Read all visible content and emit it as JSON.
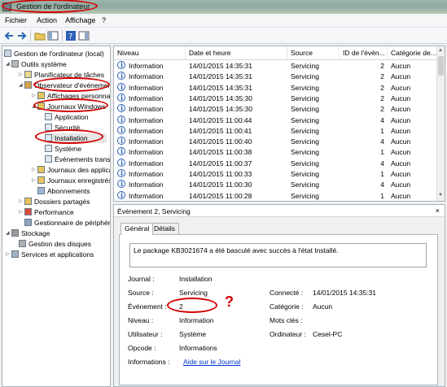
{
  "window": {
    "title": "Gestion de l'ordinateur"
  },
  "menu": {
    "items": [
      "Fichier",
      "Action",
      "Affichage",
      "?"
    ]
  },
  "toolbar": {
    "icons": [
      "back-icon",
      "forward-icon",
      "folder-icon",
      "view-icon",
      "help-icon",
      "panel-icon"
    ]
  },
  "tree": {
    "items": [
      {
        "label": "Gestion de l'ordinateur (local)"
      },
      {
        "label": "Outils système"
      },
      {
        "label": "Planificateur de tâches"
      },
      {
        "label": "Observateur d'événements"
      },
      {
        "label": "Affichages personnalisés"
      },
      {
        "label": "Journaux Windows"
      },
      {
        "label": "Application"
      },
      {
        "label": "Sécurité"
      },
      {
        "label": "Installation"
      },
      {
        "label": "Système"
      },
      {
        "label": "Événements transférés"
      },
      {
        "label": "Journaux des applications"
      },
      {
        "label": "Journaux enregistrés"
      },
      {
        "label": "Abonnements"
      },
      {
        "label": "Dossiers partagés"
      },
      {
        "label": "Performance"
      },
      {
        "label": "Gestionnaire de périphériques"
      },
      {
        "label": "Stockage"
      },
      {
        "label": "Gestion des disques"
      },
      {
        "label": "Services et applications"
      }
    ]
  },
  "list": {
    "columns": [
      "Niveau",
      "Date et heure",
      "Source",
      "ID de l'évén...",
      "Catégorie de..."
    ],
    "rows": [
      {
        "level": "Information",
        "date": "14/01/2015 14:35:31",
        "source": "Servicing",
        "id": "2",
        "category": "Aucun"
      },
      {
        "level": "Information",
        "date": "14/01/2015 14:35:31",
        "source": "Servicing",
        "id": "2",
        "category": "Aucun"
      },
      {
        "level": "Information",
        "date": "14/01/2015 14:35:31",
        "source": "Servicing",
        "id": "2",
        "category": "Aucun"
      },
      {
        "level": "Information",
        "date": "14/01/2015 14:35:30",
        "source": "Servicing",
        "id": "2",
        "category": "Aucun"
      },
      {
        "level": "Information",
        "date": "14/01/2015 14:35:30",
        "source": "Servicing",
        "id": "2",
        "category": "Aucun"
      },
      {
        "level": "Information",
        "date": "14/01/2015 11:00:44",
        "source": "Servicing",
        "id": "4",
        "category": "Aucun"
      },
      {
        "level": "Information",
        "date": "14/01/2015 11:00:41",
        "source": "Servicing",
        "id": "1",
        "category": "Aucun"
      },
      {
        "level": "Information",
        "date": "14/01/2015 11:00:40",
        "source": "Servicing",
        "id": "4",
        "category": "Aucun"
      },
      {
        "level": "Information",
        "date": "14/01/2015 11:00:38",
        "source": "Servicing",
        "id": "1",
        "category": "Aucun"
      },
      {
        "level": "Information",
        "date": "14/01/2015 11:00:37",
        "source": "Servicing",
        "id": "4",
        "category": "Aucun"
      },
      {
        "level": "Information",
        "date": "14/01/2015 11:00:33",
        "source": "Servicing",
        "id": "1",
        "category": "Aucun"
      },
      {
        "level": "Information",
        "date": "14/01/2015 11:00:30",
        "source": "Servicing",
        "id": "4",
        "category": "Aucun"
      },
      {
        "level": "Information",
        "date": "14/01/2015 11:00:28",
        "source": "Servicing",
        "id": "1",
        "category": "Aucun"
      }
    ]
  },
  "detail": {
    "title": "Événement 2, Servicing",
    "close": "×",
    "tabs": [
      "Général",
      "Détails"
    ],
    "message": "Le package KB3021674 a été basculé avec succès à l'état Installé.",
    "fields": {
      "journal_label": "Journal :",
      "journal_value": "Installation",
      "source_label": "Source :",
      "source_value": "Servicing",
      "event_label": "Événement :",
      "event_value": "2",
      "level_label": "Niveau :",
      "level_value": "Information",
      "user_label": "Utilisateur :",
      "user_value": "Système",
      "opcode_label": "Opcode :",
      "opcode_value": "Informations",
      "info_label": "Informations :",
      "info_link": "Aide sur le Journal",
      "logged_label": "Connecté :",
      "logged_value": "14/01/2015 14:35:31",
      "category_label": "Catégorie :",
      "category_value": "Aucun",
      "keywords_label": "Mots clés :",
      "keywords_value": "",
      "computer_label": "Ordinateur :",
      "computer_value": "Cesel-PC"
    },
    "annotation": "?"
  },
  "colors": {
    "annotation_red": "#d40000",
    "link_blue": "#0033cc",
    "info_blue": "#2b5fb3"
  }
}
